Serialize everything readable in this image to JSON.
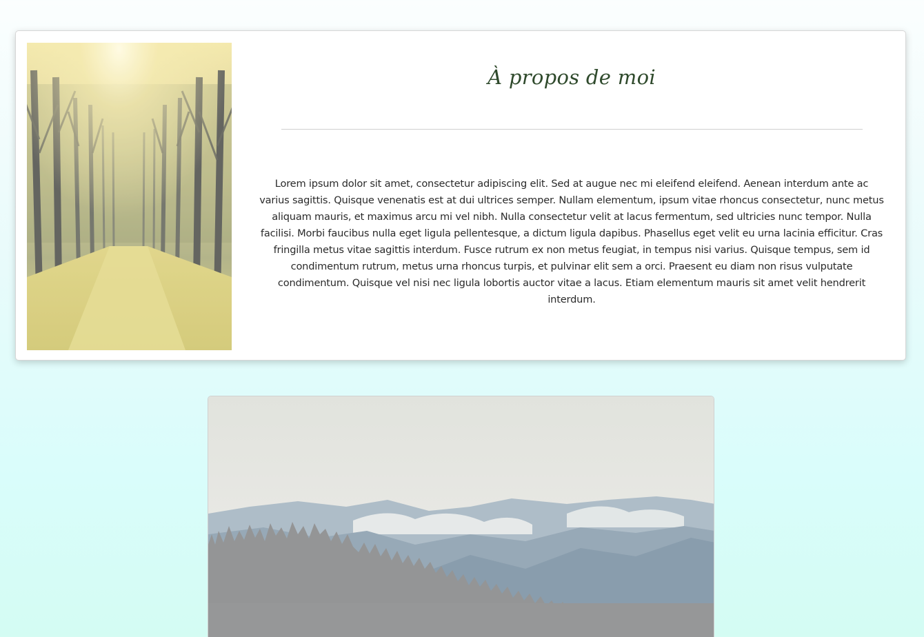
{
  "about": {
    "title": "À propos de moi",
    "paragraph": "Lorem ipsum dolor sit amet, consectetur adipiscing elit. Sed at augue nec mi eleifend eleifend. Aenean interdum ante ac varius sagittis. Quisque venenatis est at dui ultrices semper. Nullam elementum, ipsum vitae rhoncus consectetur, nunc metus aliquam mauris, et maximus arcu mi vel nibh. Nulla consectetur velit at lacus fermentum, sed ultricies nunc tempor. Nulla facilisi. Morbi faucibus nulla eget ligula pellentesque, a dictum ligula dapibus. Phasellus eget velit eu urna lacinia efficitur. Cras fringilla metus vitae sagittis interdum. Fusce rutrum ex non metus feugiat, in tempus nisi varius. Quisque tempus, sem id condimentum rutrum, metus urna rhoncus turpis, et pulvinar elit sem a orci. Praesent eu diam non risus vulputate condimentum. Quisque vel nisi nec ligula lobortis auctor vitae a lacus. Etiam elementum mauris sit amet velit hendrerit interdum.",
    "image": "sunlit-forest-path-photo"
  },
  "gallery": {
    "image": "misty-mountain-forest-photo"
  },
  "colors": {
    "title": "#2f4a2c",
    "text": "#2a2a2a",
    "divider": "#cfcfcf",
    "background_top": "#fbfefe",
    "background_bottom": "#d4fcf3"
  }
}
